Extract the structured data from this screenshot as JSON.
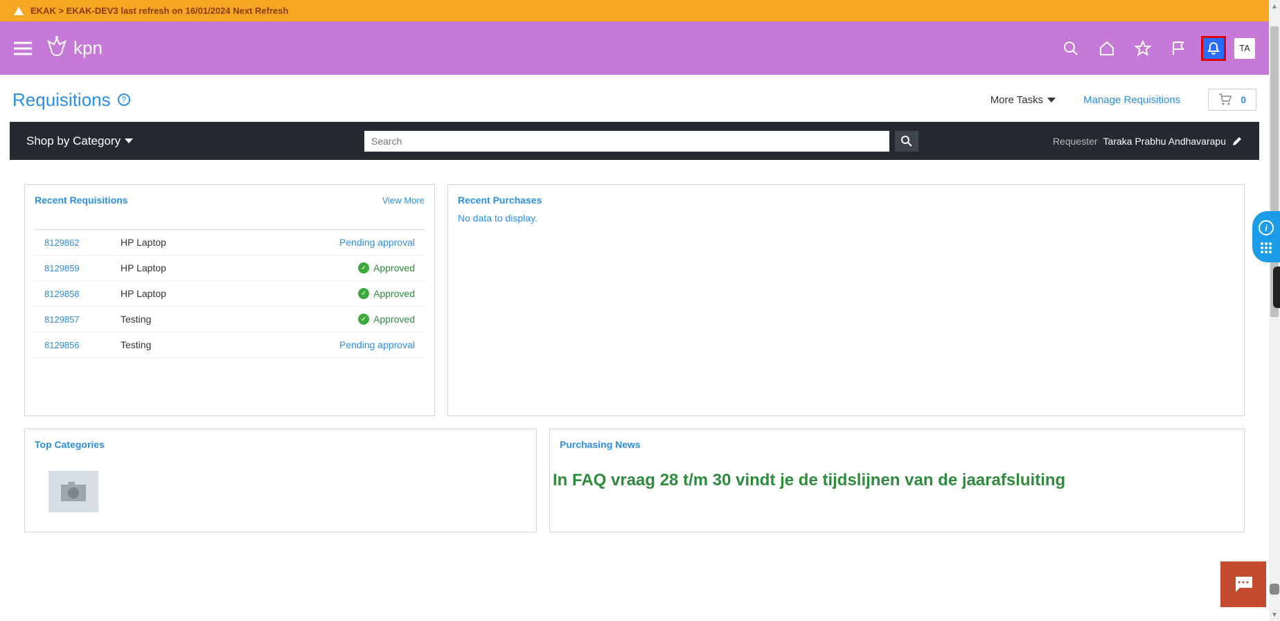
{
  "banner": "EKAK > EKAK-DEV3 last refresh on 16/01/2024 Next Refresh",
  "brand": "kpn",
  "avatar": "TA",
  "page": {
    "title": "Requisitions",
    "more_tasks": "More Tasks",
    "manage": "Manage Requisitions",
    "cart_count": "0"
  },
  "shop": {
    "label": "Shop by Category",
    "search_placeholder": "Search",
    "requester_label": "Requester",
    "requester_name": "Taraka Prabhu Andhavarapu"
  },
  "panels": {
    "recent_reqs": {
      "title": "Recent Requisitions",
      "view_more": "View More"
    },
    "recent_purchases": {
      "title": "Recent Purchases",
      "empty": "No data to display."
    },
    "top_categories": {
      "title": "Top Categories"
    },
    "news": {
      "title": "Purchasing News",
      "headline": "In FAQ vraag 28 t/m 30 vindt je de tijdslijnen van de jaarafsluiting"
    }
  },
  "reqs": [
    {
      "id": "8129862",
      "desc": "HP Laptop",
      "status": "Pending approval",
      "type": "pending"
    },
    {
      "id": "8129859",
      "desc": "HP Laptop",
      "status": "Approved",
      "type": "approved"
    },
    {
      "id": "8129858",
      "desc": "HP Laptop",
      "status": "Approved",
      "type": "approved"
    },
    {
      "id": "8129857",
      "desc": "Testing",
      "status": "Approved",
      "type": "approved"
    },
    {
      "id": "8129856",
      "desc": "Testing",
      "status": "Pending approval",
      "type": "pending"
    }
  ]
}
